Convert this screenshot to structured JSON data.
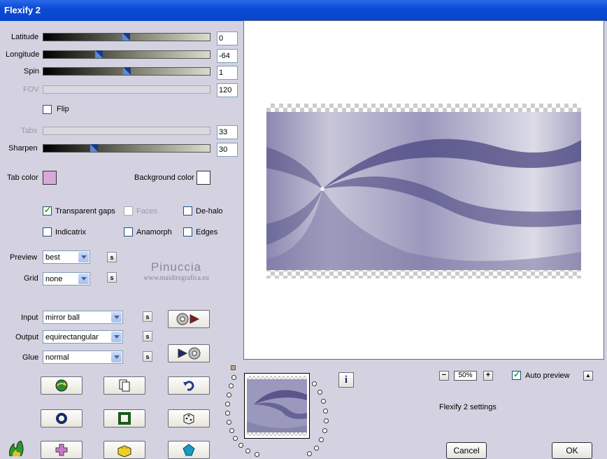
{
  "window": {
    "title": "Flexify 2"
  },
  "sliders": [
    {
      "label": "Latitude",
      "value": "0",
      "enabled": true,
      "position": 0.5
    },
    {
      "label": "Longitude",
      "value": "-64",
      "enabled": true,
      "position": 0.33
    },
    {
      "label": "Spin",
      "value": "1",
      "enabled": true,
      "position": 0.5
    },
    {
      "label": "FOV",
      "value": "120",
      "enabled": false
    },
    {
      "label": "Tabs",
      "value": "33",
      "enabled": false
    },
    {
      "label": "Sharpen",
      "value": "30",
      "enabled": true,
      "position": 0.3
    }
  ],
  "flip": {
    "label": "Flip",
    "checked": false
  },
  "colors": {
    "tab_color_label": "Tab color",
    "tab_color": "#d8a8dc",
    "background_color_label": "Background color",
    "background_color": "#ffffff"
  },
  "options": [
    {
      "label": "Transparent gaps",
      "checked": true,
      "enabled": true
    },
    {
      "label": "Faces",
      "checked": false,
      "enabled": false
    },
    {
      "label": "De-halo",
      "checked": false,
      "enabled": true
    },
    {
      "label": "Indicatrix",
      "checked": false,
      "enabled": true
    },
    {
      "label": "Anamorph",
      "checked": false,
      "enabled": true
    },
    {
      "label": "Edges",
      "checked": false,
      "enabled": true
    }
  ],
  "preview_select": {
    "label": "Preview",
    "value": "best"
  },
  "grid_select": {
    "label": "Grid",
    "value": "none"
  },
  "input_select": {
    "label": "Input",
    "value": "mirror ball"
  },
  "output_select": {
    "label": "Output",
    "value": "equirectangular"
  },
  "glue_select": {
    "label": "Glue",
    "value": "normal"
  },
  "small_button_label": "s",
  "watermark": {
    "name": "Pinuccia",
    "url": "www.maidiregrafica.eu"
  },
  "zoom": {
    "minus": "−",
    "value": "50%",
    "plus": "+"
  },
  "auto_preview": {
    "label": "Auto preview",
    "checked": true,
    "up_label": "▲"
  },
  "settings_label": "Flexify 2 settings",
  "cancel_label": "Cancel",
  "ok_label": "OK",
  "info_label": "i",
  "colors_theme": {
    "title_bar": "#0a4ad8",
    "dialog_bg": "#d4d2e0",
    "preview_purple": "#4a4680"
  }
}
